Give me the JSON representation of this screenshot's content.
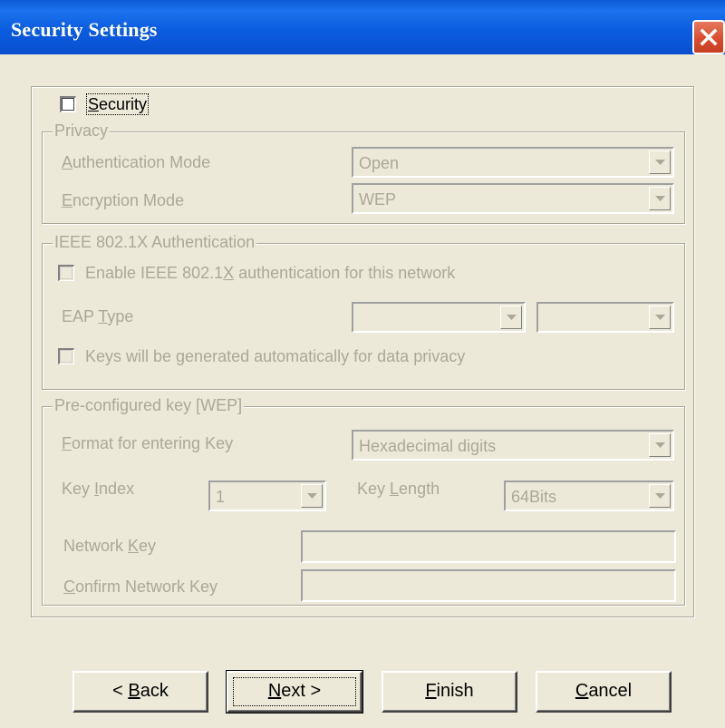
{
  "window": {
    "title": "Security Settings",
    "close_icon": "close-icon",
    "colors": {
      "titlebar": "#0a5ad6",
      "close": "#d9492b",
      "face": "#ece9d8",
      "disabled_text": "#aca899"
    }
  },
  "security": {
    "label_pre": "",
    "label_key": "S",
    "label_post": "ecurity",
    "checked": false
  },
  "privacy": {
    "legend": "Privacy",
    "auth_mode": {
      "label_key": "A",
      "label_post": "uthentication Mode",
      "value": "Open"
    },
    "enc_mode": {
      "label_key": "E",
      "label_post": "ncryption Mode",
      "value": "WEP"
    }
  },
  "ieee": {
    "legend": "IEEE 802.1X Authentication",
    "enable": {
      "pre": "Enable IEEE 802.1",
      "key": "X",
      "post": " authentication for this network",
      "checked": false
    },
    "eap": {
      "pre": "EAP ",
      "key": "T",
      "post": "ype",
      "value1": "",
      "value2": ""
    },
    "keys": {
      "label": "Keys will be generated automatically for data privacy",
      "checked": false
    }
  },
  "wep": {
    "legend": "Pre-configured key [WEP]",
    "format": {
      "key": "F",
      "post": "ormat for entering Key",
      "value": "Hexadecimal digits"
    },
    "key_index": {
      "pre": "Key ",
      "key": "I",
      "post": "ndex",
      "value": "1"
    },
    "key_length": {
      "pre": "Key ",
      "key": "L",
      "post": "ength",
      "value": "64Bits"
    },
    "network_key": {
      "pre": "Network ",
      "key": "K",
      "post": "ey",
      "value": ""
    },
    "confirm_key": {
      "key": "C",
      "post": "onfirm Network Key",
      "value": ""
    }
  },
  "buttons": {
    "back": {
      "pre": "< ",
      "key": "B",
      "post": "ack"
    },
    "next": {
      "pre": "",
      "key": "N",
      "post": "ext >"
    },
    "finish": {
      "pre": "",
      "key": "F",
      "post": "inish"
    },
    "cancel": {
      "pre": "",
      "key": "C",
      "post": "ancel"
    }
  }
}
